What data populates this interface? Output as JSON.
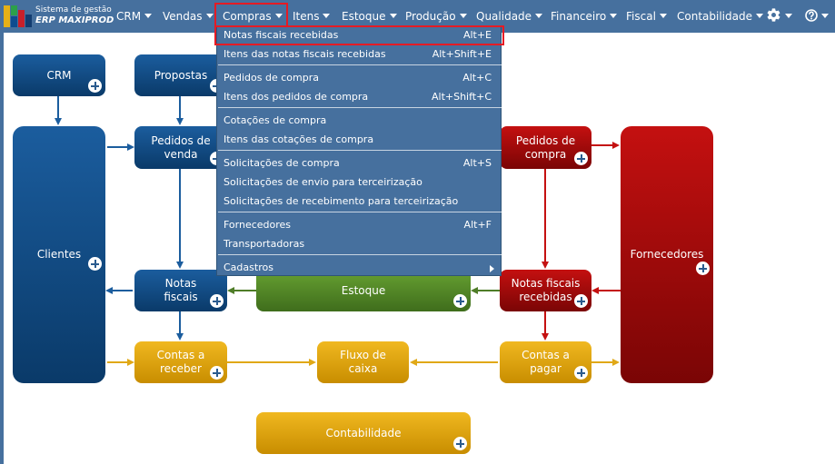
{
  "brand": {
    "line1": "Sistema de gestão",
    "line2": "ERP MAXIPROD"
  },
  "menu": {
    "crm": "CRM",
    "vendas": "Vendas",
    "compras": "Compras",
    "itens": "Itens",
    "estoque": "Estoque",
    "producao": "Produção",
    "qualidade": "Qualidade",
    "financeiro": "Financeiro",
    "fiscal": "Fiscal",
    "contabilidade": "Contabilidade"
  },
  "icons": {
    "settings": "gear-icon",
    "help": "question-icon",
    "add": "plus-icon"
  },
  "dropdown": {
    "items": [
      {
        "label": "Notas fiscais recebidas",
        "shortcut": "Alt+E"
      },
      {
        "label": "Itens das notas fiscais recebidas",
        "shortcut": "Alt+Shift+E"
      },
      {
        "label": "Pedidos de compra",
        "shortcut": "Alt+C"
      },
      {
        "label": "Itens dos pedidos de compra",
        "shortcut": "Alt+Shift+C"
      },
      {
        "label": "Cotações de compra",
        "shortcut": ""
      },
      {
        "label": "Itens das cotações de compra",
        "shortcut": ""
      },
      {
        "label": "Solicitações de compra",
        "shortcut": "Alt+S"
      },
      {
        "label": "Solicitações de envio para terceirização",
        "shortcut": ""
      },
      {
        "label": "Solicitações de recebimento para terceirização",
        "shortcut": ""
      },
      {
        "label": "Fornecedores",
        "shortcut": "Alt+F"
      },
      {
        "label": "Transportadoras",
        "shortcut": ""
      },
      {
        "label": "Cadastros",
        "shortcut": ""
      }
    ]
  },
  "diagram": {
    "crm": "CRM",
    "propostas": "Propostas",
    "pedidos_venda_1": "Pedidos de",
    "pedidos_venda_2": "venda",
    "clientes": "Clientes",
    "notas_fiscais_1": "Notas",
    "notas_fiscais_2": "fiscais",
    "estoque": "Estoque",
    "pedidos_compra_1": "Pedidos de",
    "pedidos_compra_2": "compra",
    "notas_recebidas_1": "Notas fiscais",
    "notas_recebidas_2": "recebidas",
    "fornecedores": "Fornecedores",
    "contas_receber_1": "Contas a",
    "contas_receber_2": "receber",
    "fluxo_caixa_1": "Fluxo de",
    "fluxo_caixa_2": "caixa",
    "contas_pagar_1": "Contas a",
    "contas_pagar_2": "pagar",
    "contabilidade": "Contabilidade"
  },
  "colors": {
    "navbar": "#46709e",
    "blue": "#1b5d9e",
    "red": "#c41010",
    "green": "#67a132",
    "gold": "#f0b820",
    "highlight": "#e51b24"
  }
}
